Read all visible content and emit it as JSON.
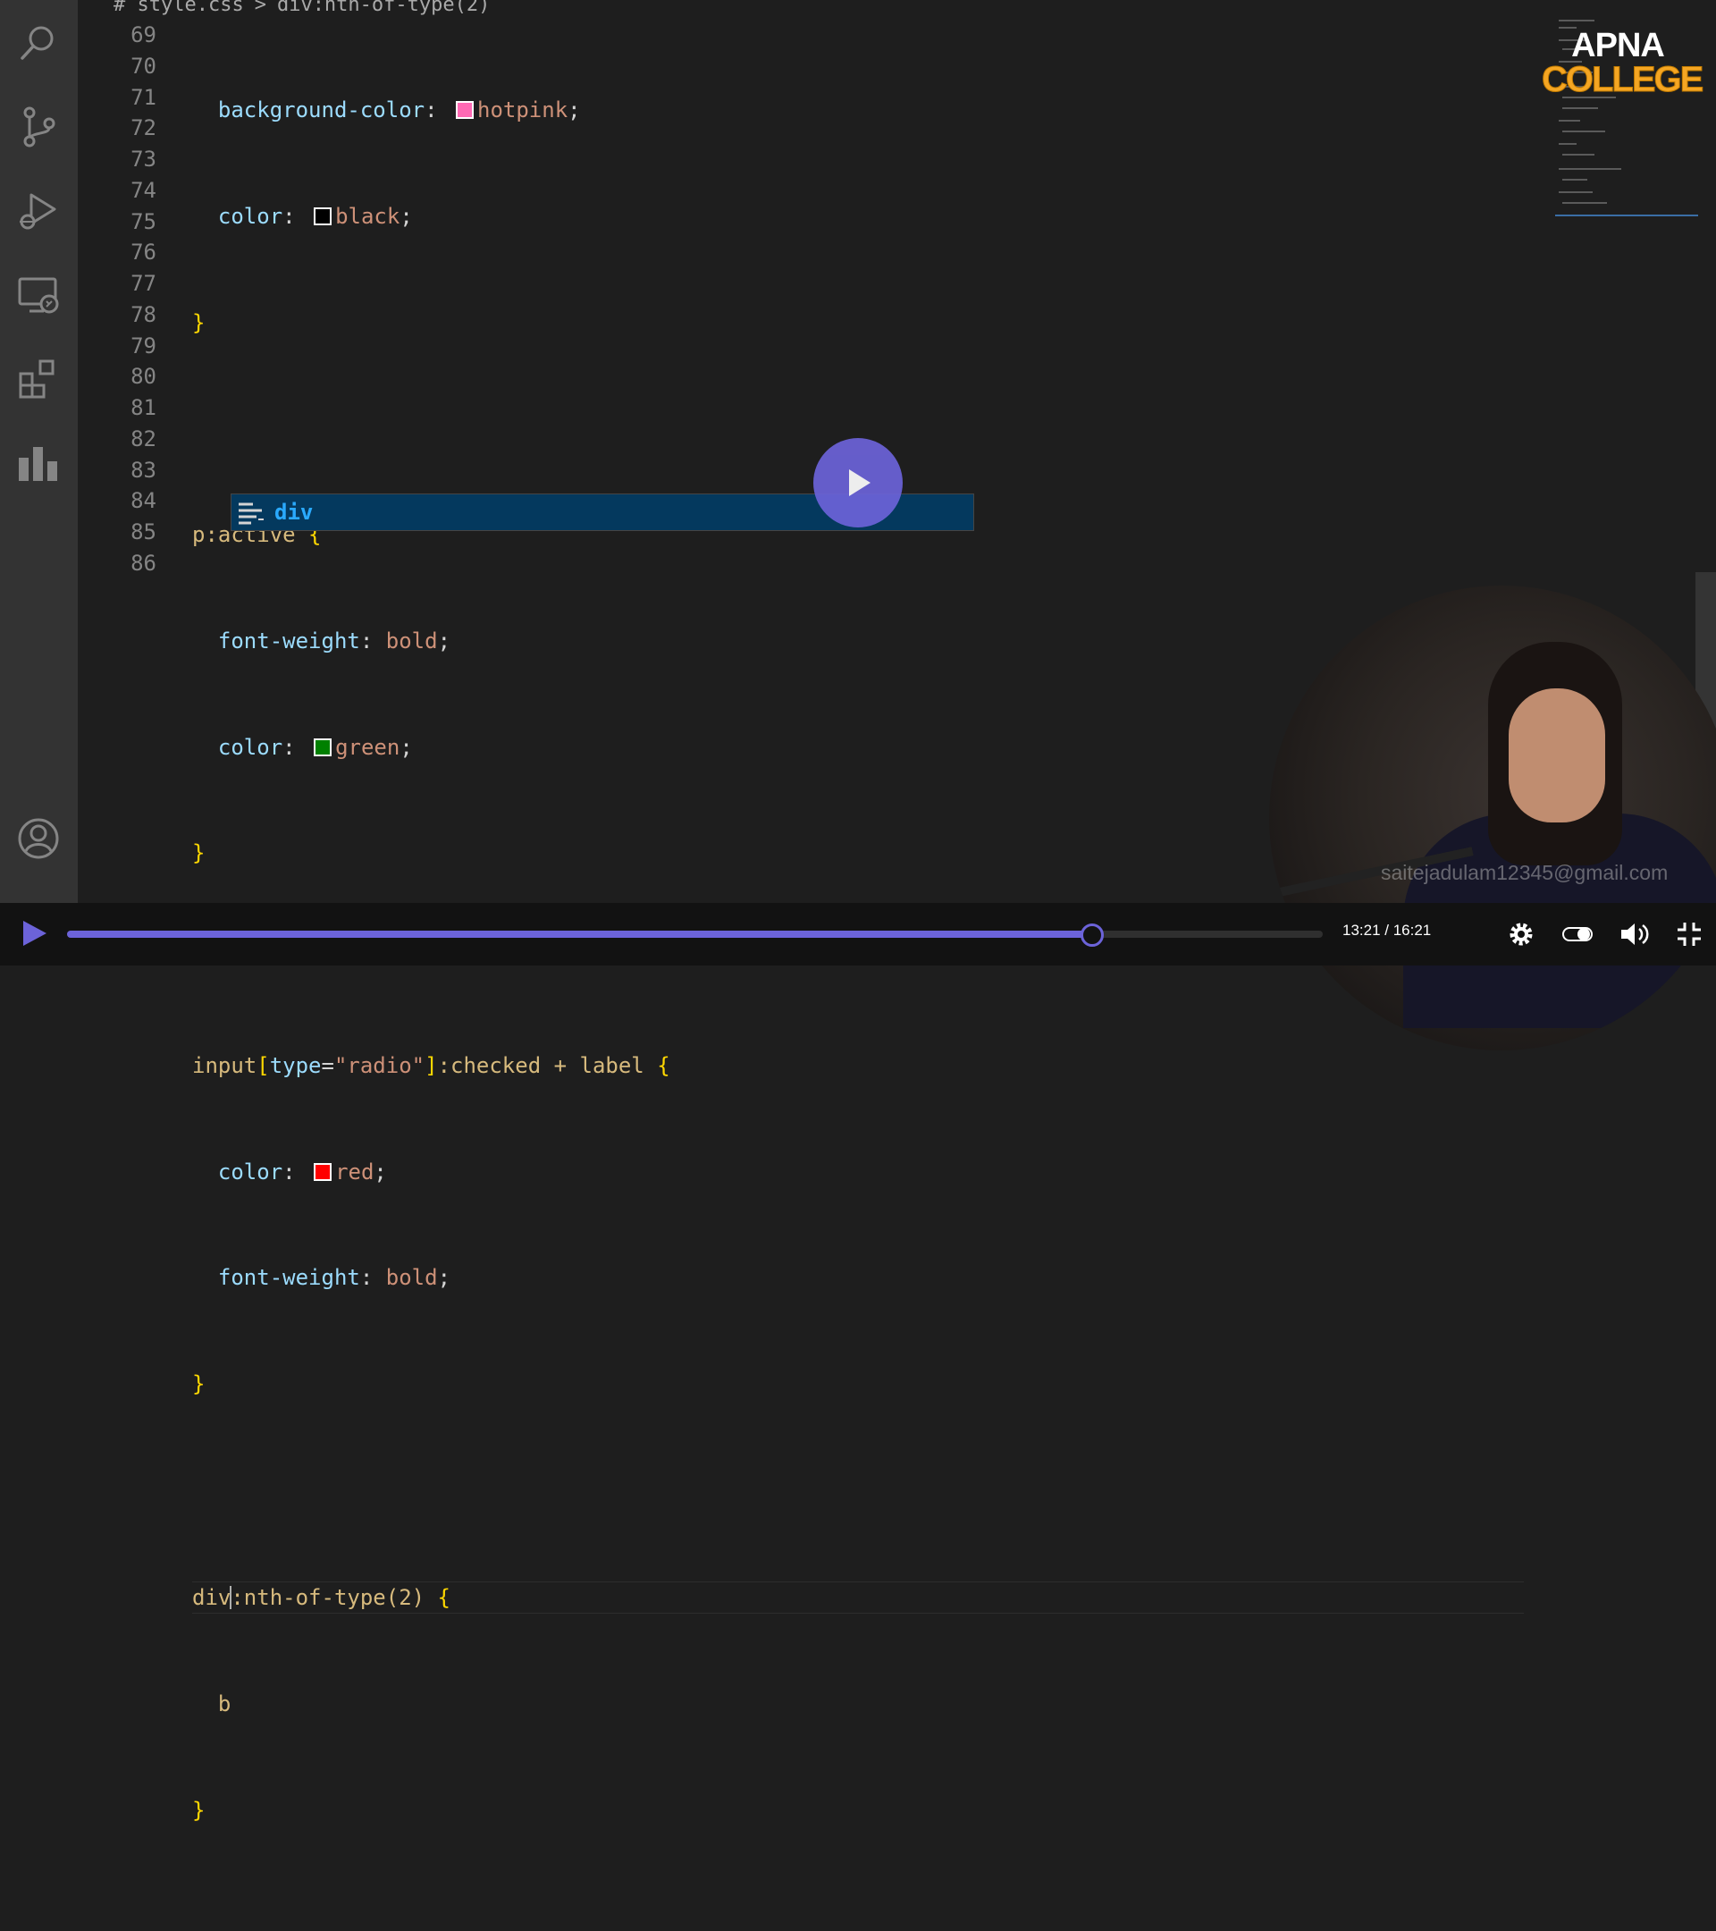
{
  "breadcrumb": {
    "file": "# style.css",
    "sep": ">",
    "symbol": "div:nth-of-type(2)"
  },
  "gutter": [
    "69",
    "70",
    "71",
    "72",
    "73",
    "74",
    "75",
    "76",
    "77",
    "78",
    "79",
    "80",
    "81",
    "82",
    "83",
    "84",
    "85",
    "86"
  ],
  "code": {
    "l69": {
      "prop": "background-color",
      "colon": ": ",
      "value": "hotpink",
      "semi": ";"
    },
    "l70": {
      "prop": "color",
      "colon": ": ",
      "value": "black",
      "semi": ";"
    },
    "l71": {
      "brace": "}"
    },
    "l73": {
      "sel": "p:active",
      "brace": " {"
    },
    "l74": {
      "prop": "font-weight",
      "colon": ": ",
      "value": "bold",
      "semi": ";"
    },
    "l75": {
      "prop": "color",
      "colon": ": ",
      "value": "green",
      "semi": ";"
    },
    "l76": {
      "brace": "}"
    },
    "l78": {
      "sel1": "input",
      "b1": "[",
      "attr": "type",
      "eq": "=",
      "str": "\"radio\"",
      "b2": "]",
      "sel2": ":checked + label",
      "brace": " {"
    },
    "l79": {
      "prop": "color",
      "colon": ": ",
      "value": "red",
      "semi": ";"
    },
    "l80": {
      "prop": "font-weight",
      "colon": ": ",
      "value": "bold",
      "semi": ";"
    },
    "l81": {
      "brace": "}"
    },
    "l83": {
      "sel1": "div",
      "sel2": ":nth-of-type(2)",
      "brace": " {"
    },
    "l84": {
      "text": "b"
    },
    "l85": {
      "brace": "}"
    }
  },
  "swatches": {
    "hotpink": "#ff69b4",
    "black": "#000000",
    "green": "#008000",
    "red": "#ff0000"
  },
  "suggest": {
    "icon": "snippet-icon",
    "label": "div"
  },
  "logo": {
    "line1": "APNA",
    "line2": "COLLEGE"
  },
  "watermark": "saitejadulam12345@gmail.com",
  "player": {
    "time": "13:21 / 16:21",
    "progress": 0.816,
    "accent": "#6c63d9"
  },
  "activity_icons": [
    "search-icon",
    "source-control-icon",
    "run-debug-icon",
    "remote-explorer-icon",
    "extensions-icon",
    "stats-icon",
    "account-icon"
  ]
}
